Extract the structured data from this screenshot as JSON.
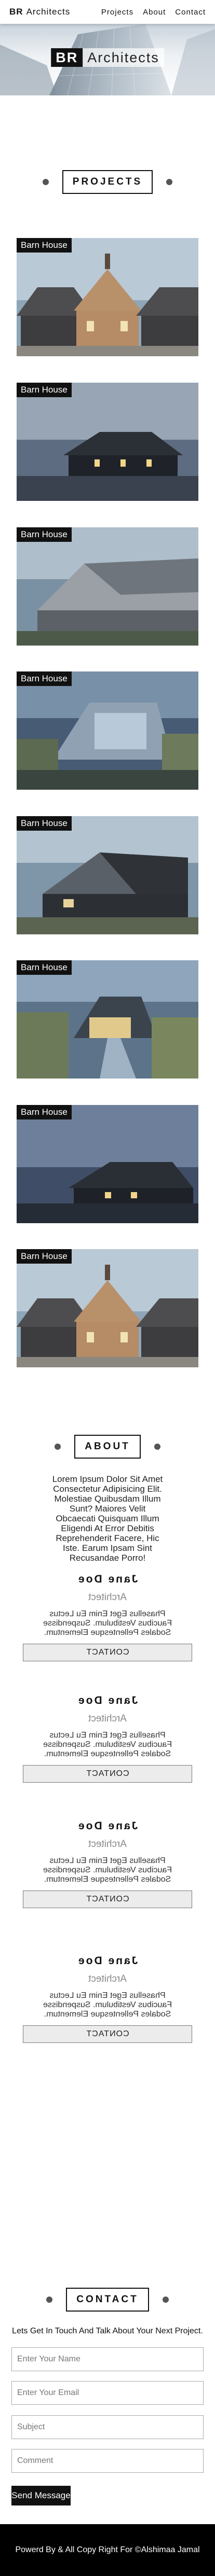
{
  "nav": {
    "brand_bold": "BR",
    "brand_rest": "Architects",
    "links": [
      "Projects",
      "About",
      "Contact"
    ]
  },
  "hero": {
    "title_bold": "BR",
    "title_rest": "Architects"
  },
  "projects": {
    "heading": "PROJECTS",
    "cards": [
      {
        "label": "Barn House"
      },
      {
        "label": "Barn House"
      },
      {
        "label": "Barn House"
      },
      {
        "label": "Barn House"
      },
      {
        "label": "Barn House"
      },
      {
        "label": "Barn House"
      },
      {
        "label": "Barn House"
      },
      {
        "label": "Barn House"
      }
    ]
  },
  "about": {
    "heading": "ABOUT",
    "text_lines": [
      "Lorem Ipsum Dolor Sit Amet",
      "Consectetur Adipisicing Elit.",
      "Molestiae Quibusdam Illum",
      "Sunt? Maiores Velit",
      "Obcaecati Quisquam Illum",
      "Eligendi At Error Debitis",
      "Reprehenderit Facere, Hic",
      "Iste. Earum Ipsam Sint",
      "Recusandae Porro!"
    ],
    "team": [
      {
        "name": "Jane Doe",
        "role": "Architect",
        "desc_lines": [
          "Phasellus Eget Enim Eu Lectus",
          "Faucibus Vestibulum. Suspendisse",
          "Sodales Pellentesque Elementum."
        ],
        "button": "CONTACT"
      },
      {
        "name": "Jane Doe",
        "role": "Architect",
        "desc_lines": [
          "Phasellus Eget Enim Eu Lectus",
          "Faucibus Vestibulum. Suspendisse",
          "Sodales Pellentesque Elementum."
        ],
        "button": "CONTACT"
      },
      {
        "name": "Jane Doe",
        "role": "Architect",
        "desc_lines": [
          "Phasellus Eget Enim Eu Lectus",
          "Faucibus Vestibulum. Suspendisse",
          "Sodales Pellentesque Elementum."
        ],
        "button": "CONTACT"
      },
      {
        "name": "Jane Doe",
        "role": "Architect",
        "desc_lines": [
          "Phasellus Eget Enim Eu Lectus",
          "Faucibus Vestibulum. Suspendisse",
          "Sodales Pellentesque Elementum."
        ],
        "button": "CONTACT"
      }
    ]
  },
  "contact": {
    "heading": "CONTACT",
    "lead": "Lets Get In Touch And Talk About Your Next Project.",
    "fields": {
      "name": {
        "placeholder": "Enter Your Name",
        "value": ""
      },
      "email": {
        "placeholder": "Enter Your Email",
        "value": ""
      },
      "subject": {
        "placeholder": "Subject",
        "value": ""
      },
      "comment": {
        "placeholder": "Comment",
        "value": ""
      }
    },
    "send_label": "Send Message"
  },
  "footer": {
    "text": "Powerd By & All Copy Right For ©Alshimaa Jamal"
  },
  "colors": {
    "footer_bg": "#000000",
    "button_bg": "#111111",
    "label_bg": "#111111",
    "muted_text": "#888888"
  }
}
